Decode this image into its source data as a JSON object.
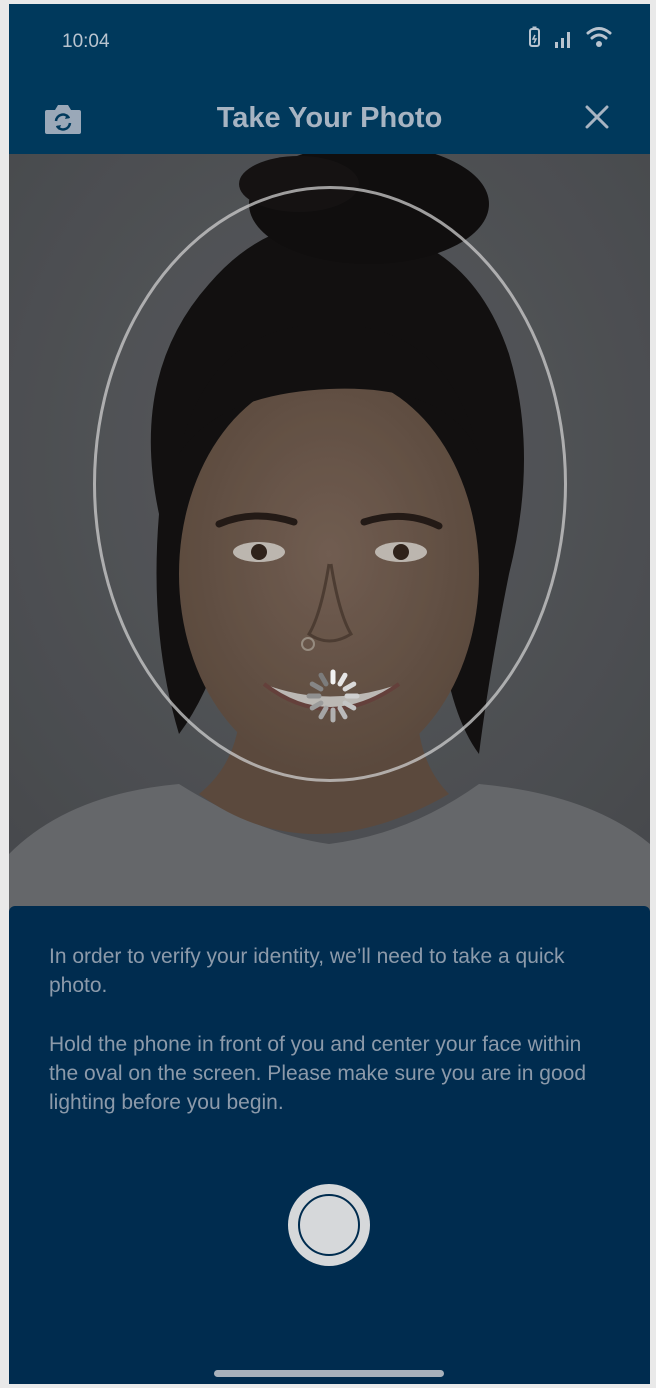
{
  "status_bar": {
    "time": "10:04",
    "icons": [
      "battery-icon",
      "signal-icon",
      "wifi-icon"
    ]
  },
  "header": {
    "title": "Take Your Photo",
    "left_icon": "flip-camera-icon",
    "right_icon": "close-icon"
  },
  "camera": {
    "overlay": "face-oval",
    "spinner": "loading-spinner-icon"
  },
  "instructions": {
    "paragraph1": "In order to verify your identity, we’ll need to take a quick photo.",
    "paragraph2": "Hold the phone in front of you and center your face within the oval on the screen. Please make sure you are in good lighting before you begin."
  },
  "colors": {
    "header_bg": "#00395c",
    "sheet_bg": "#002c4f",
    "text": "#8c9aaa"
  }
}
